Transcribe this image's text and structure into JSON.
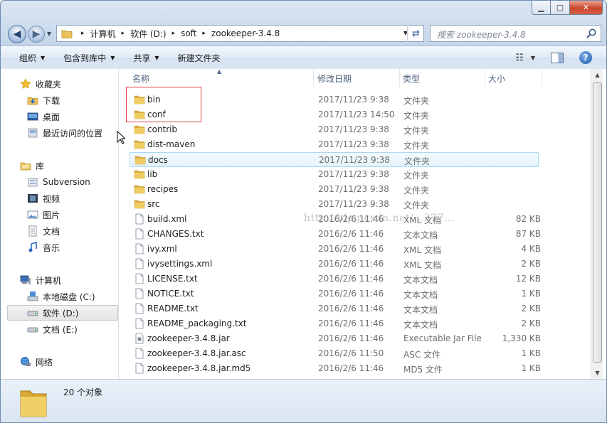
{
  "address": {
    "crumbs": [
      "计算机",
      "软件 (D:)",
      "soft",
      "zookeeper-3.4.8"
    ]
  },
  "search": {
    "placeholder": "搜索 zookeeper-3.4.8"
  },
  "toolbar": {
    "organize": "组织",
    "include_in_library": "包含到库中",
    "share": "共享",
    "new_folder": "新建文件夹"
  },
  "nav": {
    "favorites": "收藏夹",
    "downloads": "下载",
    "desktop": "桌面",
    "recent": "最近访问的位置",
    "libraries": "库",
    "subversion": "Subversion",
    "videos": "视频",
    "pictures": "图片",
    "documents": "文档",
    "music": "音乐",
    "computer": "计算机",
    "drive_c": "本地磁盘 (C:)",
    "drive_d": "软件 (D:)",
    "drive_e": "文档 (E:)",
    "network": "网络"
  },
  "columns": {
    "name": "名称",
    "date": "修改日期",
    "type": "类型",
    "size": "大小"
  },
  "files": [
    {
      "name": "bin",
      "date": "2017/11/23 9:38",
      "type": "文件夹",
      "size": "",
      "icon": "folder-icon"
    },
    {
      "name": "conf",
      "date": "2017/11/23 14:50",
      "type": "文件夹",
      "size": "",
      "icon": "folder-icon"
    },
    {
      "name": "contrib",
      "date": "2017/11/23 9:38",
      "type": "文件夹",
      "size": "",
      "icon": "folder-icon"
    },
    {
      "name": "dist-maven",
      "date": "2017/11/23 9:38",
      "type": "文件夹",
      "size": "",
      "icon": "folder-icon"
    },
    {
      "name": "docs",
      "date": "2017/11/23 9:38",
      "type": "文件夹",
      "size": "",
      "icon": "folder-icon"
    },
    {
      "name": "lib",
      "date": "2017/11/23 9:38",
      "type": "文件夹",
      "size": "",
      "icon": "folder-icon"
    },
    {
      "name": "recipes",
      "date": "2017/11/23 9:38",
      "type": "文件夹",
      "size": "",
      "icon": "folder-icon"
    },
    {
      "name": "src",
      "date": "2017/11/23 9:38",
      "type": "文件夹",
      "size": "",
      "icon": "folder-icon"
    },
    {
      "name": "build.xml",
      "date": "2016/2/6 11:46",
      "type": "XML 文档",
      "size": "82 KB",
      "icon": "document-icon"
    },
    {
      "name": "CHANGES.txt",
      "date": "2016/2/6 11:46",
      "type": "文本文档",
      "size": "87 KB",
      "icon": "document-icon"
    },
    {
      "name": "ivy.xml",
      "date": "2016/2/6 11:46",
      "type": "XML 文档",
      "size": "4 KB",
      "icon": "document-icon"
    },
    {
      "name": "ivysettings.xml",
      "date": "2016/2/6 11:46",
      "type": "XML 文档",
      "size": "2 KB",
      "icon": "document-icon"
    },
    {
      "name": "LICENSE.txt",
      "date": "2016/2/6 11:46",
      "type": "文本文档",
      "size": "12 KB",
      "icon": "document-icon"
    },
    {
      "name": "NOTICE.txt",
      "date": "2016/2/6 11:46",
      "type": "文本文档",
      "size": "1 KB",
      "icon": "document-icon"
    },
    {
      "name": "README.txt",
      "date": "2016/2/6 11:46",
      "type": "文本文档",
      "size": "2 KB",
      "icon": "document-icon"
    },
    {
      "name": "README_packaging.txt",
      "date": "2016/2/6 11:46",
      "type": "文本文档",
      "size": "2 KB",
      "icon": "document-icon"
    },
    {
      "name": "zookeeper-3.4.8.jar",
      "date": "2016/2/6 11:46",
      "type": "Executable Jar File",
      "size": "1,330 KB",
      "icon": "jar-icon"
    },
    {
      "name": "zookeeper-3.4.8.jar.asc",
      "date": "2016/2/6 11:50",
      "type": "ASC 文件",
      "size": "1 KB",
      "icon": "document-icon"
    },
    {
      "name": "zookeeper-3.4.8.jar.md5",
      "date": "2016/2/6 11:46",
      "type": "MD5 文件",
      "size": "1 KB",
      "icon": "document-icon"
    }
  ],
  "status": {
    "count": "20 个对象"
  },
  "watermark": "http://blog.csdn.net/…377…",
  "colors": {
    "accent": "#2b5797",
    "highlight": "#e23c3c",
    "folder": "#e8c25a"
  }
}
